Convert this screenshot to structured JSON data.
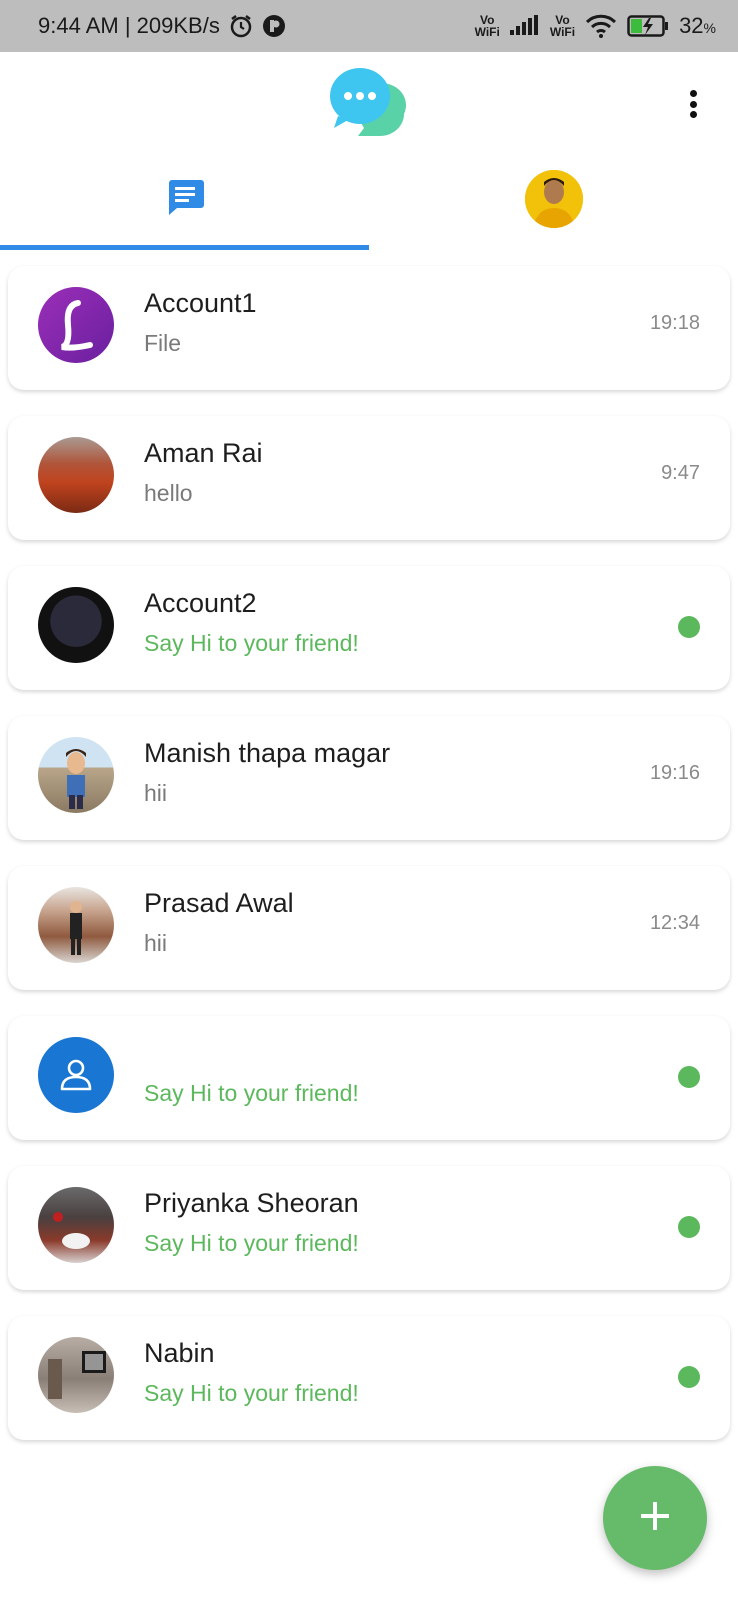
{
  "status_bar": {
    "time_speed": "9:44 AM | 209KB/s",
    "vo_wifi": "Vo\nWiFi",
    "battery_pct": "32",
    "battery_unit": "%"
  },
  "header": {
    "logo_icon": "chat-bubbles-logo",
    "more_icon": "more-vertical-icon"
  },
  "tabs": [
    {
      "icon": "chat-icon",
      "active": true
    },
    {
      "icon": "profile-avatar",
      "active": false
    }
  ],
  "chats": [
    {
      "name": "Account1",
      "message": "File",
      "time": "19:18",
      "online": false
    },
    {
      "name": "Aman Rai",
      "message": "hello",
      "time": "9:47",
      "online": false
    },
    {
      "name": "Account2",
      "message": "Say Hi to your friend!",
      "time": "",
      "online": true
    },
    {
      "name": "Manish thapa magar",
      "message": "hii",
      "time": "19:16",
      "online": false
    },
    {
      "name": "Prasad Awal",
      "message": "hii",
      "time": "12:34",
      "online": false
    },
    {
      "name": "",
      "message": "Say Hi to your friend!",
      "time": "",
      "online": true
    },
    {
      "name": "Priyanka Sheoran",
      "message": "Say Hi to your friend!",
      "time": "",
      "online": true
    },
    {
      "name": "Nabin",
      "message": "Say Hi to your friend!",
      "time": "",
      "online": true
    }
  ],
  "colors": {
    "accent_blue": "#2f8be6",
    "online_green": "#5cb85c",
    "fab_green": "#66bb6a"
  },
  "fab": {
    "icon": "plus-icon"
  }
}
